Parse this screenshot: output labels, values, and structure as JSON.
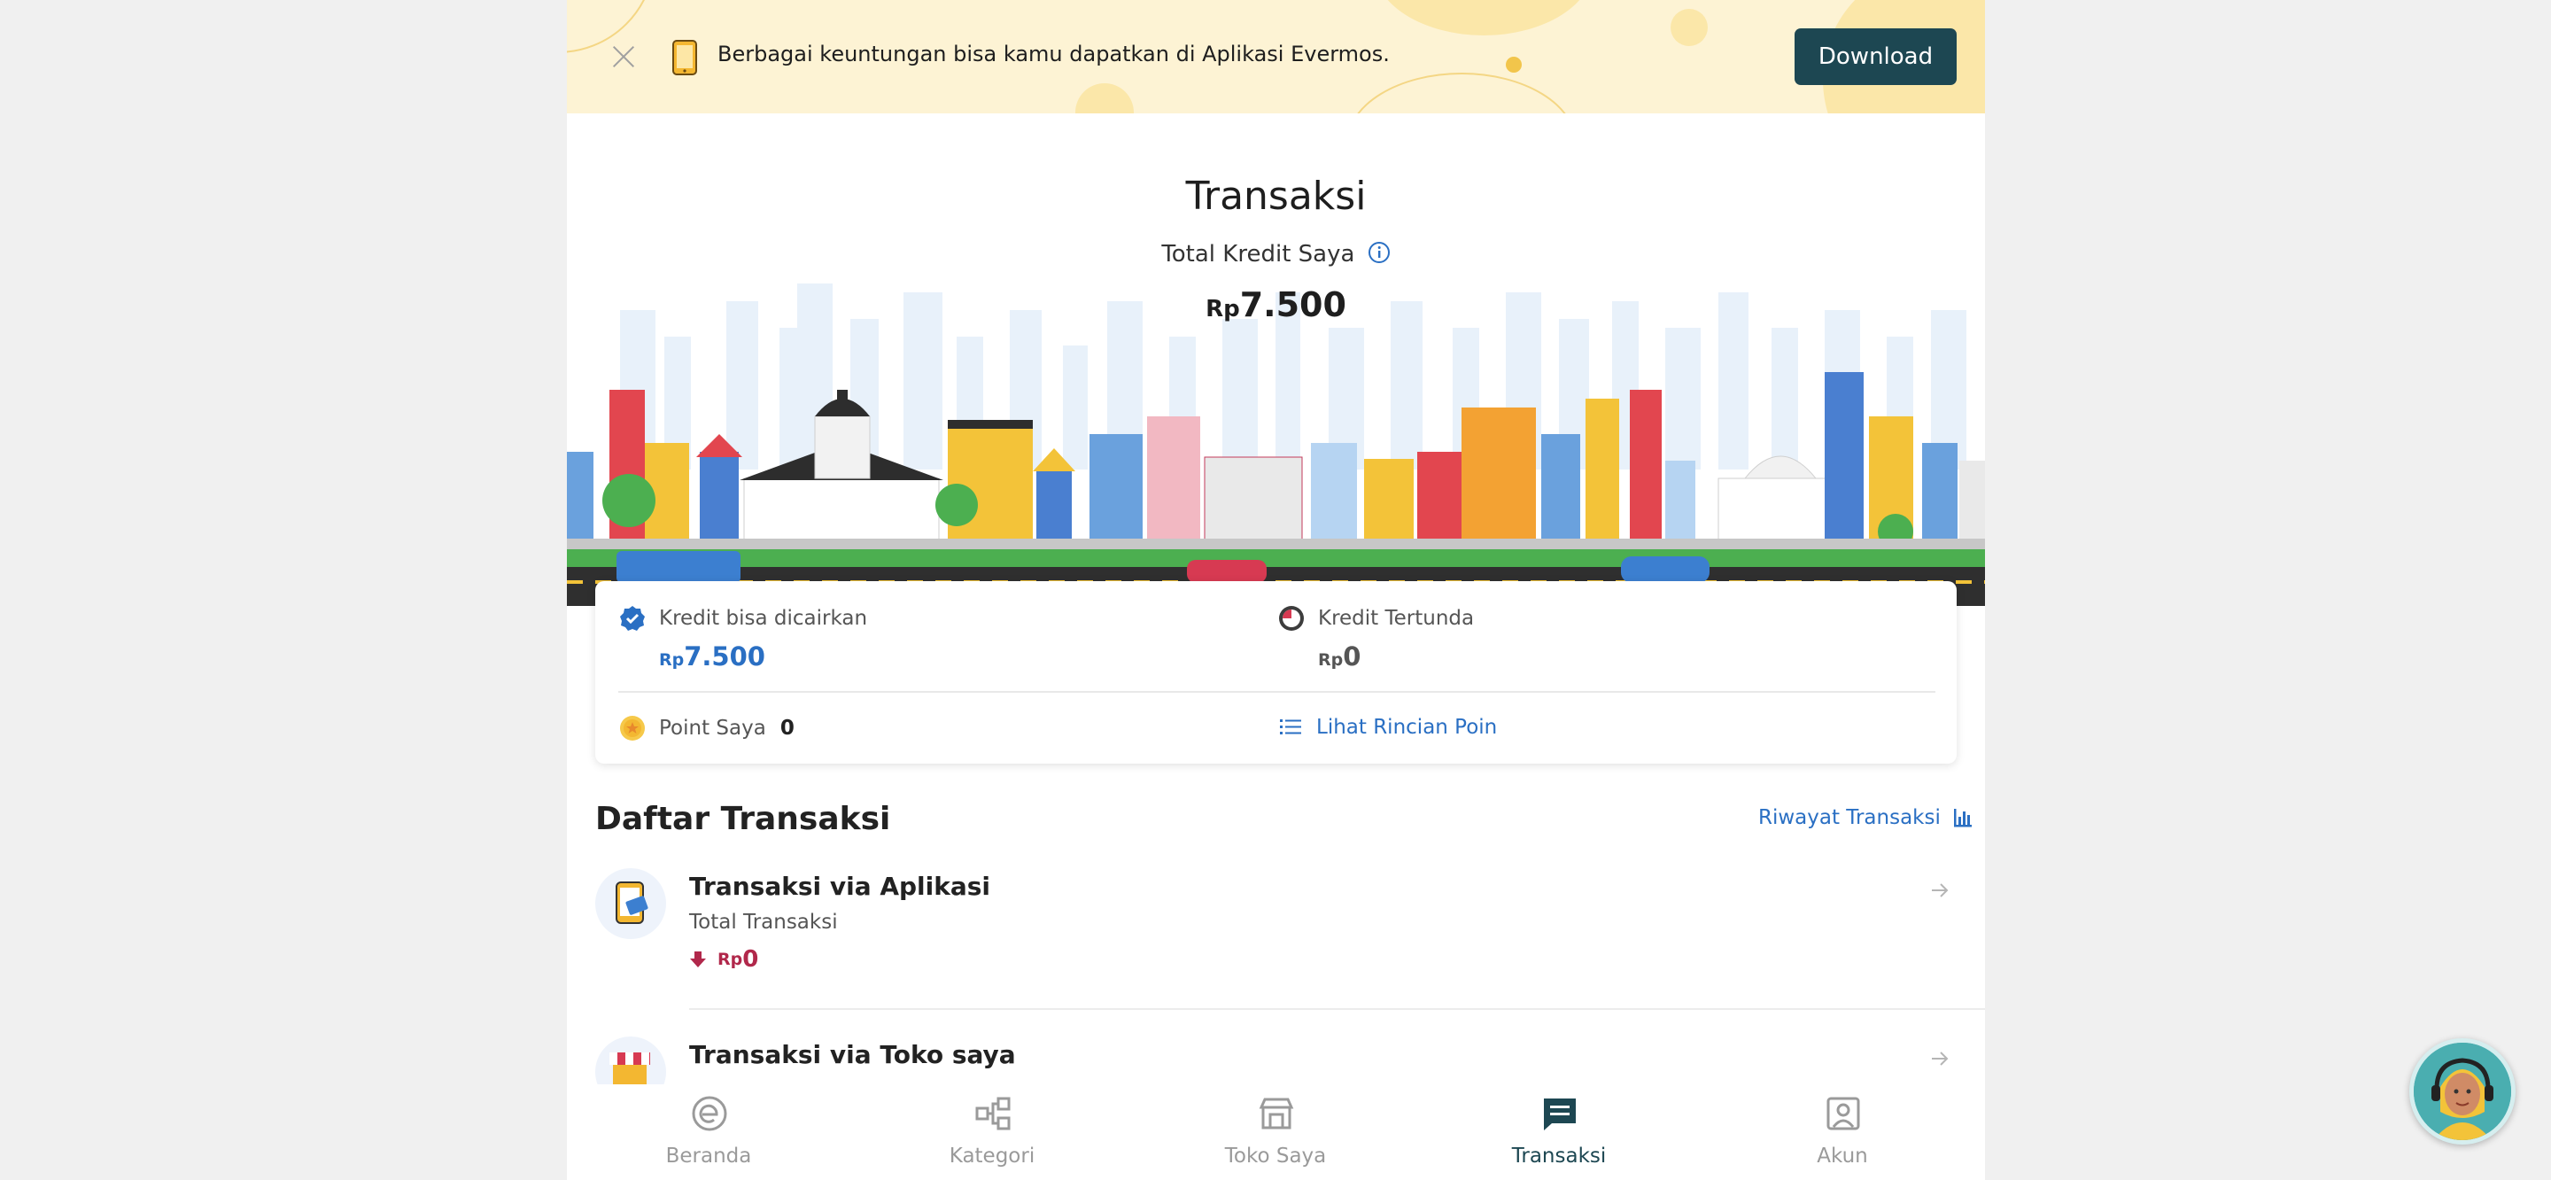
{
  "banner": {
    "text": "Berbagai keuntungan bisa kamu dapatkan di Aplikasi Evermos.",
    "download_label": "Download"
  },
  "header": {
    "title": "Transaksi",
    "total_kredit_label": "Total Kredit Saya",
    "total_kredit_currency": "Rp",
    "total_kredit_value": "7.500"
  },
  "credit": {
    "cairkan_label": "Kredit bisa dicairkan",
    "cairkan_currency": "Rp",
    "cairkan_value": "7.500",
    "tertunda_label": "Kredit Tertunda",
    "tertunda_currency": "Rp",
    "tertunda_value": "0",
    "point_label": "Point Saya",
    "point_value": "0",
    "rincian_label": "Lihat Rincian Poin"
  },
  "daftar": {
    "title": "Daftar Transaksi",
    "riwayat_label": "Riwayat Transaksi",
    "items": [
      {
        "title": "Transaksi via Aplikasi",
        "subtitle": "Total Transaksi",
        "currency": "Rp",
        "value": "0"
      },
      {
        "title": "Transaksi via Toko saya"
      }
    ]
  },
  "nav": {
    "items": [
      {
        "label": "Beranda",
        "icon": "home-e-icon"
      },
      {
        "label": "Kategori",
        "icon": "category-tree-icon"
      },
      {
        "label": "Toko Saya",
        "icon": "store-icon"
      },
      {
        "label": "Transaksi",
        "icon": "chat-list-icon",
        "active": true
      },
      {
        "label": "Akun",
        "icon": "account-icon"
      }
    ]
  },
  "colors": {
    "brand_dark": "#1d4752",
    "link_blue": "#2a6fc3",
    "negative_red": "#b1284b",
    "banner_bg": "#fdf3d4"
  }
}
